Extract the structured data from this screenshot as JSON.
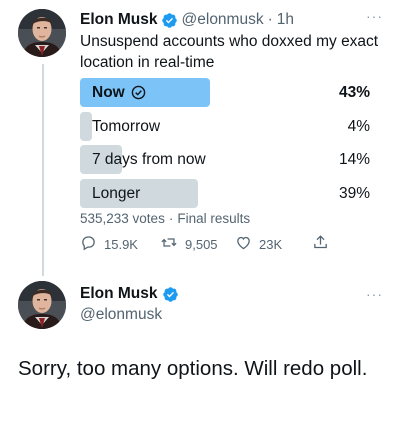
{
  "tweet": {
    "author": {
      "name": "Elon Musk",
      "handle": "@elonmusk",
      "verified": true,
      "avatar": "elon-musk-avatar"
    },
    "time": "1h",
    "separator": "·",
    "text": "Unsuspend accounts who doxxed my exact location in real-time",
    "poll": {
      "options": [
        {
          "label": "Now",
          "percent": "43%",
          "value": 43,
          "winner": true
        },
        {
          "label": "Tomorrow",
          "percent": "4%",
          "value": 4,
          "winner": false
        },
        {
          "label": "7 days from now",
          "percent": "14%",
          "value": 14,
          "winner": false
        },
        {
          "label": "Longer",
          "percent": "39%",
          "value": 39,
          "winner": false
        }
      ],
      "votes": "535,233 votes",
      "status": "Final results"
    },
    "actions": {
      "replies": "15.9K",
      "retweets": "9,505",
      "likes": "23K"
    }
  },
  "reply": {
    "author": {
      "name": "Elon Musk",
      "handle": "@elonmusk",
      "verified": true,
      "avatar": "elon-musk-avatar"
    },
    "text": "Sorry, too many options. Will redo poll."
  },
  "colors": {
    "accent": "#1d9bf0",
    "winner_bar": "#7cc3f8",
    "bar": "#cfd9de",
    "secondary_text": "#536471"
  },
  "icons": {
    "more": "more-icon",
    "verified": "verified-badge-icon",
    "check": "check-circle-icon",
    "reply": "reply-icon",
    "retweet": "retweet-icon",
    "like": "heart-icon",
    "share": "share-icon"
  }
}
